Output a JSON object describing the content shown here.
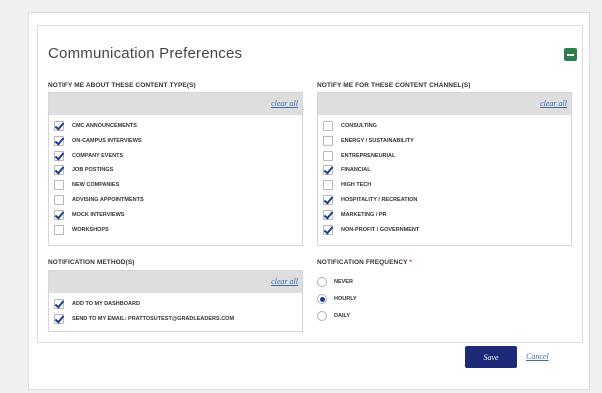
{
  "panel": {
    "title": "Communication Preferences"
  },
  "content_types": {
    "label": "NOTIFY ME ABOUT THESE CONTENT TYPE(S)",
    "clear_all": "clear all",
    "options": [
      {
        "label": "CMC ANNOUNCEMENTS",
        "checked": true
      },
      {
        "label": "ON-CAMPUS INTERVIEWS",
        "checked": true
      },
      {
        "label": "COMPANY EVENTS",
        "checked": true
      },
      {
        "label": "JOB POSTINGS",
        "checked": true
      },
      {
        "label": "NEW COMPANIES",
        "checked": false
      },
      {
        "label": "ADVISING APPOINTMENTS",
        "checked": false
      },
      {
        "label": "MOCK INTERVIEWS",
        "checked": true
      },
      {
        "label": "WORKSHOPS",
        "checked": false
      }
    ]
  },
  "content_channels": {
    "label": "NOTIFY ME FOR THESE CONTENT CHANNEL(S)",
    "clear_all": "clear all",
    "options": [
      {
        "label": "CONSULTING",
        "checked": false
      },
      {
        "label": "ENERGY / SUSTAINABILITY",
        "checked": false
      },
      {
        "label": "ENTREPRENEURIAL",
        "checked": false
      },
      {
        "label": "FINANCIAL",
        "checked": true
      },
      {
        "label": "HIGH TECH",
        "checked": false
      },
      {
        "label": "HOSPITALITY / RECREATION",
        "checked": true
      },
      {
        "label": "MARKETING / PR",
        "checked": true
      },
      {
        "label": "NON-PROFIT / GOVERNMENT",
        "checked": true
      }
    ]
  },
  "methods": {
    "label": "NOTIFICATION METHOD(S)",
    "clear_all": "clear all",
    "options": [
      {
        "label": "ADD TO MY DASHBOARD",
        "checked": true
      },
      {
        "label": "SEND TO MY EMAIL: PRATTOSUTEST@GRADLEADERS.COM",
        "checked": true
      }
    ]
  },
  "frequency": {
    "label": "NOTIFICATION FREQUENCY",
    "required_mark": "*",
    "options": [
      {
        "label": "NEVER",
        "selected": false
      },
      {
        "label": "HOURLY",
        "selected": true
      },
      {
        "label": "DAILY",
        "selected": false
      }
    ]
  },
  "actions": {
    "save": "Save",
    "cancel": "Cancel"
  },
  "colors": {
    "primary": "#1c2a78",
    "link": "#3a6fb0",
    "check": "#1c3d8e",
    "collapse": "#2e7d4f",
    "required": "#c0392b"
  }
}
